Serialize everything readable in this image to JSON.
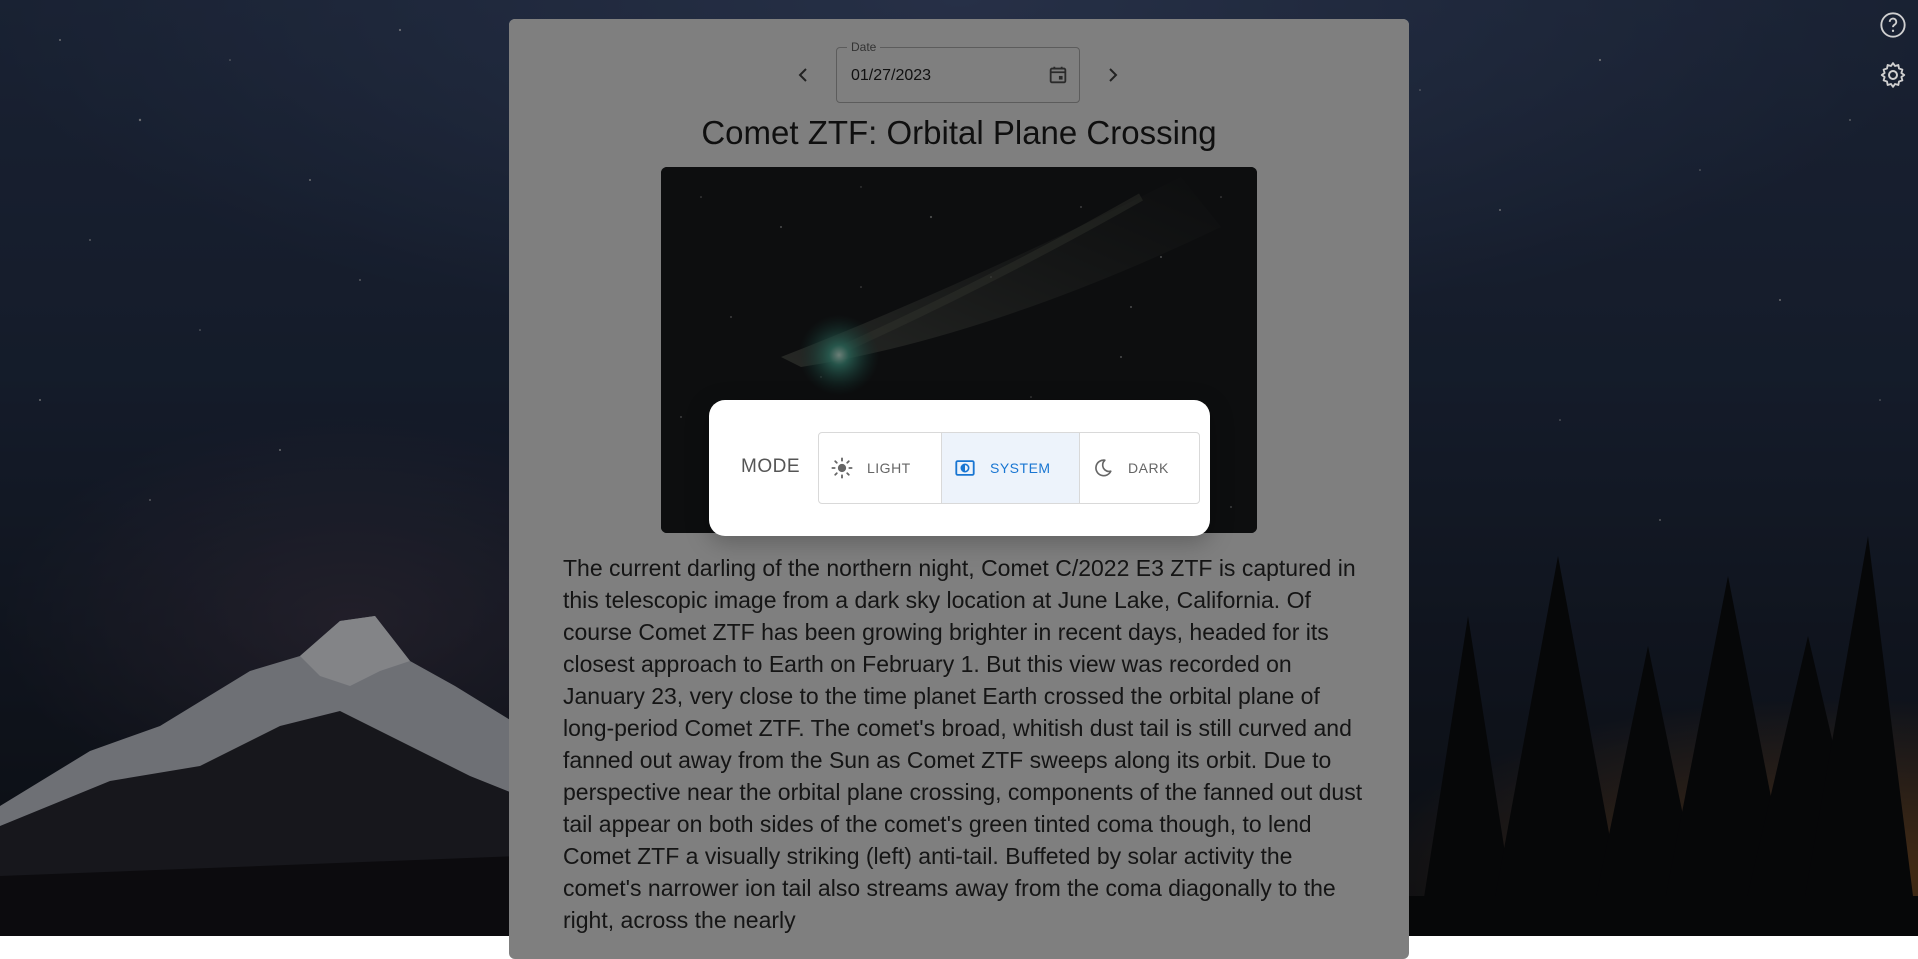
{
  "page": {
    "date": {
      "label": "Date",
      "value": "01/27/2023"
    },
    "title": "Comet ZTF: Orbital Plane Crossing",
    "description": "The current darling of the northern night, Comet C/2022 E3 ZTF is captured in this telescopic image from a dark sky location at June Lake, California. Of course Comet ZTF has been growing brighter in recent days, headed for its closest approach to Earth on February 1. But this view was recorded on January 23, very close to the time planet Earth crossed the orbital plane of long-period Comet ZTF. The comet's broad, whitish dust tail is still curved and fanned out away from the Sun as Comet ZTF sweeps along its orbit. Due to perspective near the orbital plane crossing, components of the fanned out dust tail appear on both sides of the comet's green tinted coma though, to lend Comet ZTF a visually striking (left) anti-tail. Buffeted by solar activity the comet's narrower ion tail also streams away from the coma diagonally to the right, across the nearly"
  },
  "icons": {
    "prev": "chevron-left-icon",
    "next": "chevron-right-icon",
    "calendar": "calendar-icon",
    "help": "help-circle-icon",
    "settings": "gear-icon",
    "light": "sun-icon",
    "system": "system-mode-icon",
    "dark": "moon-icon"
  },
  "mode_dialog": {
    "label": "MODE",
    "options": [
      {
        "label": "LIGHT",
        "selected": false
      },
      {
        "label": "SYSTEM",
        "selected": true
      },
      {
        "label": "DARK",
        "selected": false
      }
    ]
  },
  "colors": {
    "accent": "#1976d2",
    "selected_bg": "#edf3fb"
  }
}
